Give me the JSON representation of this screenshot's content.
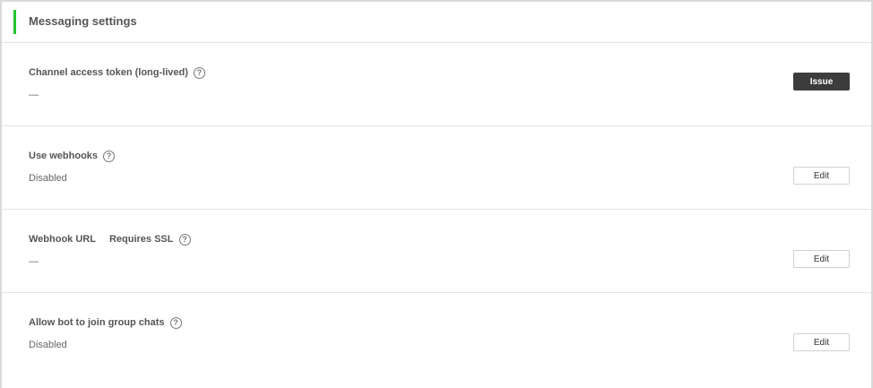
{
  "section": {
    "title": "Messaging settings",
    "accent_color": "#22c32e"
  },
  "rows": [
    {
      "label": "Channel access token (long-lived)",
      "help_icon": "question-circle-icon",
      "value": "—",
      "action": "Issue"
    },
    {
      "label": "Use webhooks",
      "help_icon": "question-circle-icon",
      "value": "Disabled",
      "action": "Edit"
    },
    {
      "label": "Webhook URL",
      "sublabel": "Requires SSL",
      "help_icon": "question-circle-icon",
      "value": "—",
      "action": "Edit"
    },
    {
      "label": "Allow bot to join group chats",
      "help_icon": "question-circle-icon",
      "value": "Disabled",
      "action": "Edit"
    }
  ],
  "help_glyph": "?"
}
